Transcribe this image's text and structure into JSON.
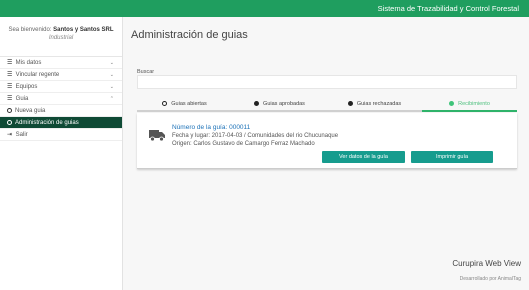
{
  "topbar": {
    "title": "Sistema de Trazabilidad y Control Forestal"
  },
  "sidebar": {
    "welcome_prefix": "Sea bienvenido:",
    "user": "Santos y Santos SRL",
    "role": "Industrial",
    "items": [
      {
        "label": "Mis datos",
        "icon": "list-icon",
        "chevron": "⌄"
      },
      {
        "label": "Vincular regente",
        "icon": "list-icon",
        "chevron": "⌄"
      },
      {
        "label": "Equipos",
        "icon": "list-icon",
        "chevron": "⌄"
      },
      {
        "label": "Guia",
        "icon": "list-icon",
        "chevron": "⌃"
      },
      {
        "label": "Nueva guia",
        "icon": "circle-icon"
      },
      {
        "label": "Administración de guias",
        "icon": "circle-icon"
      },
      {
        "label": "Salir",
        "icon": "exit-icon"
      }
    ]
  },
  "main": {
    "title": "Administración de guias",
    "search": {
      "label": "Buscar",
      "value": ""
    },
    "tabs": [
      {
        "label": "Guias abiertas",
        "icon": "circle-outline-icon"
      },
      {
        "label": "Guias aprobadas",
        "icon": "check-circle-icon"
      },
      {
        "label": "Guias rechazadas",
        "icon": "exclamation-circle-icon"
      },
      {
        "label": "Recibimiento",
        "icon": "dot-icon"
      }
    ],
    "guide": {
      "number_label": "Número de la guía: 000011",
      "date_place": "Fecha y lugar: 2017-04-03 / Comunidades del rio Chucunaque",
      "origin": "Origen: Carlos Gustavo de Camargo Ferraz Machado",
      "view_label": "Ver datos de la guía",
      "print_label": "Imprimir guía"
    },
    "footer": {
      "brand": "Curupira Web View",
      "dev": "Desarrollado por AnimalTag"
    }
  },
  "colors": {
    "topbar": "#1f9e5f",
    "active_menu": "#0f4a35",
    "button": "#169c8e",
    "tab_active": "#2fb36a"
  }
}
